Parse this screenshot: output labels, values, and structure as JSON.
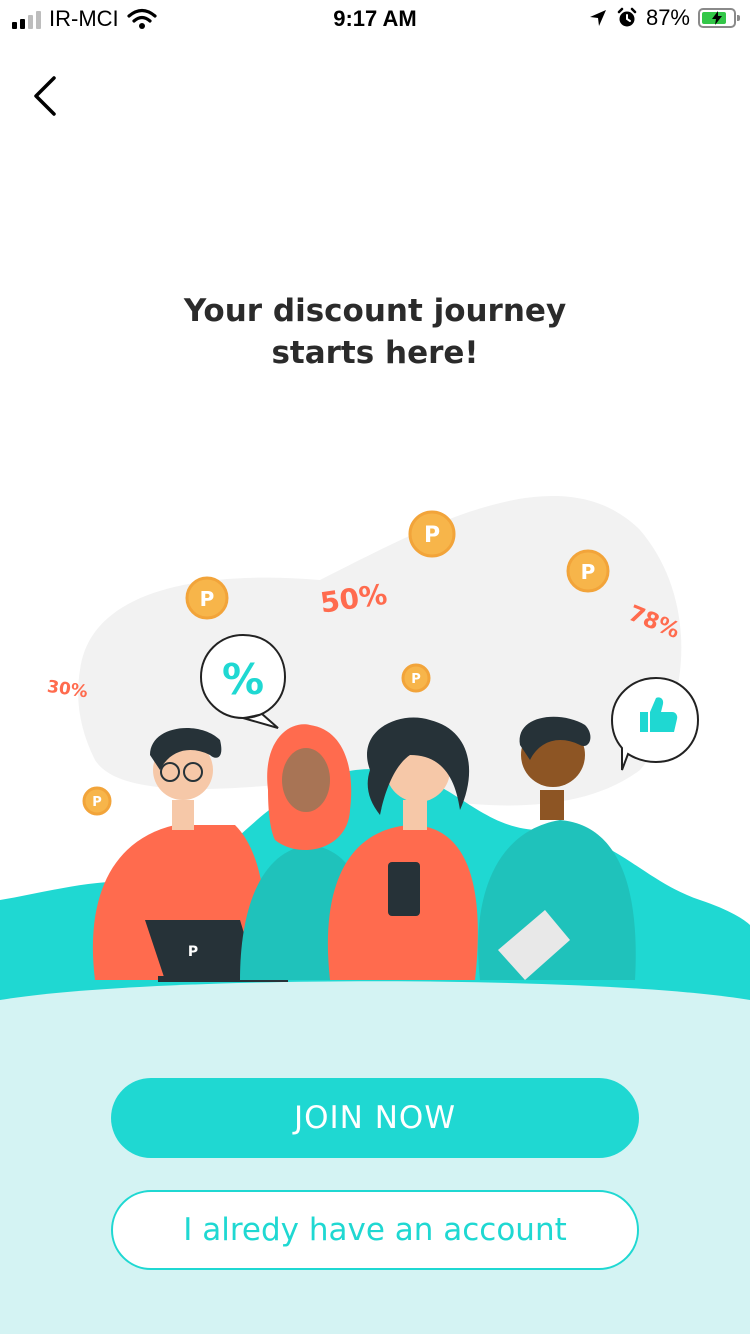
{
  "status_bar": {
    "carrier": "IR-MCI",
    "time": "9:17 AM",
    "battery_percent": "87%",
    "signal_bars": 2,
    "icons": [
      "signal-icon",
      "wifi-icon",
      "location-arrow-icon",
      "alarm-icon",
      "battery-charging-icon"
    ]
  },
  "nav": {
    "back_icon": "chevron-left-icon"
  },
  "headline": {
    "line1": "Your discount journey",
    "line2": "starts here!"
  },
  "illustration": {
    "badges": [
      "50%",
      "78%",
      "30%",
      "%"
    ],
    "coin_letter": "P",
    "laptop_logo": "P",
    "colors": {
      "teal": "#1fd8d2",
      "coral": "#ff6b4e",
      "coin": "#f7b54a",
      "blob": "#f2f2f2"
    }
  },
  "actions": {
    "join_label": "JOIN NOW",
    "login_label": "I alredy have an account"
  },
  "colors": {
    "accent": "#1fd8d2",
    "panel_bg": "#d4f3f3",
    "headline": "#2b2b2b"
  }
}
